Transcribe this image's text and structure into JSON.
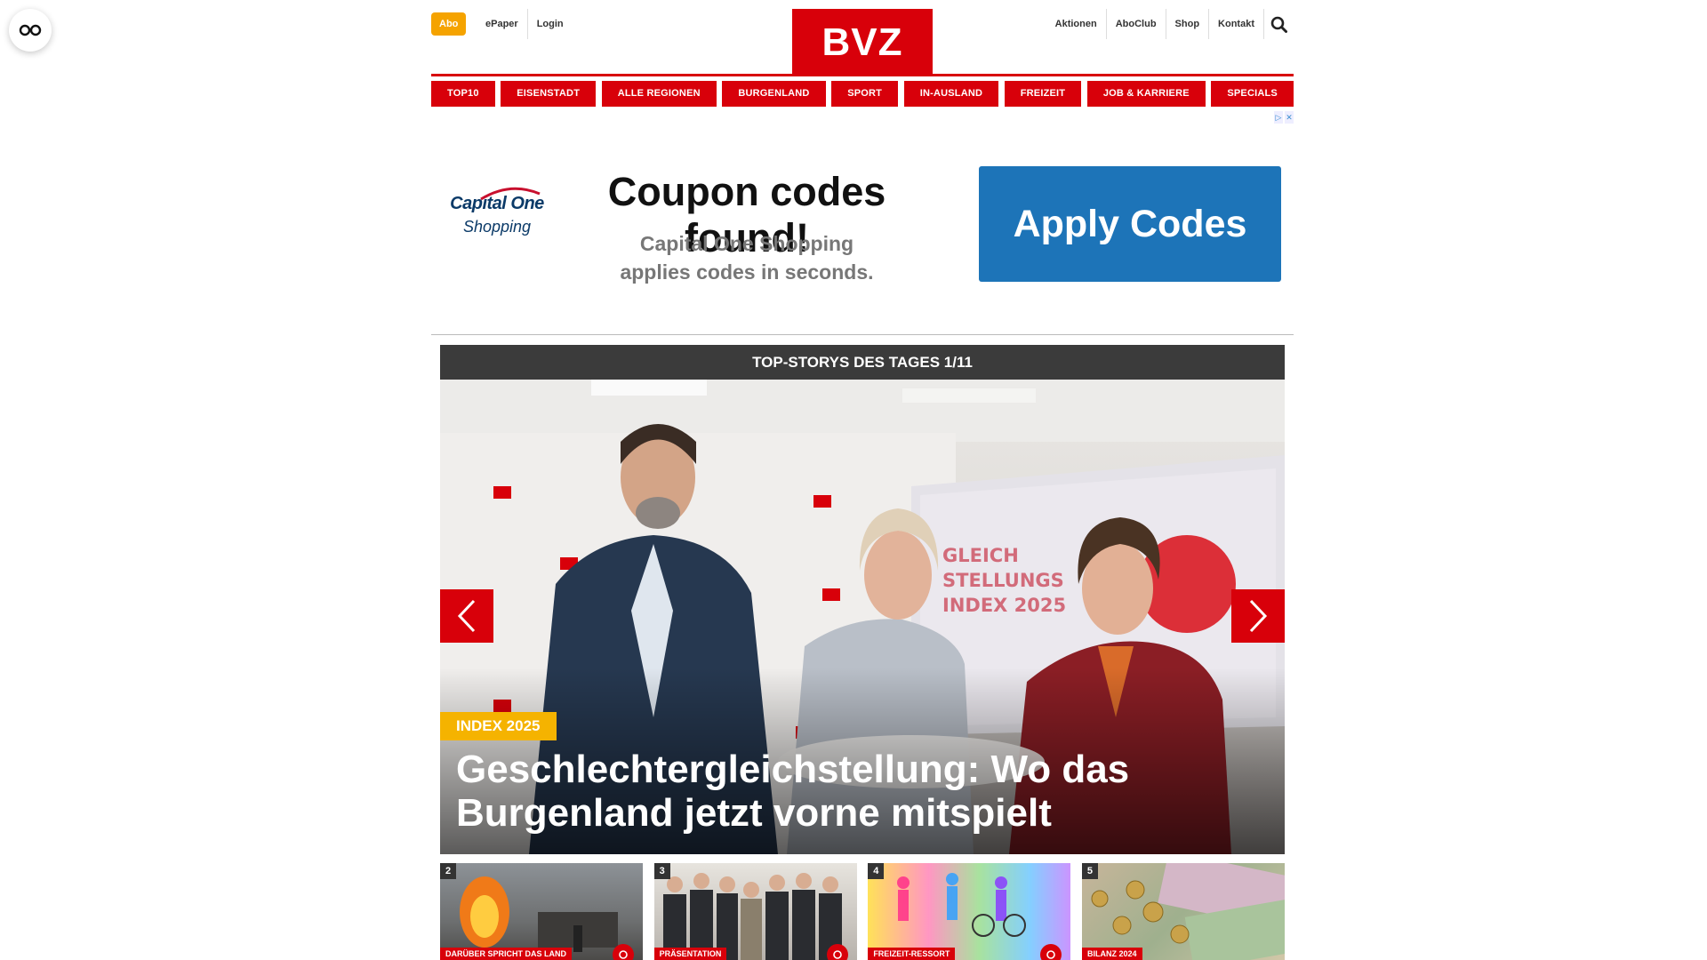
{
  "header": {
    "abo_label": "Abo",
    "left_links": [
      "ePaper",
      "Login"
    ],
    "logo_text": "BVZ",
    "right_links": [
      "Aktionen",
      "AboClub",
      "Shop",
      "Kontakt"
    ]
  },
  "nav": {
    "items": [
      "TOP10",
      "EISENSTADT",
      "ALLE REGIONEN",
      "BURGENLAND",
      "SPORT",
      "IN-AUSLAND",
      "FREIZEIT",
      "JOB & KARRIERE",
      "SPECIALS"
    ]
  },
  "ad": {
    "brand": "Capital One",
    "brand_sub": "Shopping",
    "headline": "Coupon codes found!",
    "sub_line1": "Capital One Shopping",
    "sub_line2": "applies codes in seconds.",
    "cta": "Apply Codes"
  },
  "top_stories": {
    "bar_title": "TOP-STORYS DES TAGES 1/11",
    "hero": {
      "kicker": "INDEX 2025",
      "title": "Geschlechtergleichstellung: Wo das Burgenland jetzt vorne mitspielt",
      "screen_text": [
        "GLEICH",
        "STELLUNGS",
        "INDEX 2025"
      ]
    },
    "thumbnails": [
      {
        "number": "2",
        "tag": "DARÜBER SPRICHT DAS LAND",
        "icon": "camera-icon"
      },
      {
        "number": "3",
        "tag": "PRÄSENTATION",
        "icon": "camera-icon"
      },
      {
        "number": "4",
        "tag": "FREIZEIT-RESSORT",
        "icon": "camera-icon"
      },
      {
        "number": "5",
        "tag": "BILANZ 2024",
        "icon": null
      }
    ]
  },
  "colors": {
    "brand_red": "#d8000a",
    "abo_orange": "#f5a300",
    "kicker_yellow": "#f5b300",
    "ad_blue": "#1d74b8",
    "bar_dark": "#3b3b3b"
  }
}
